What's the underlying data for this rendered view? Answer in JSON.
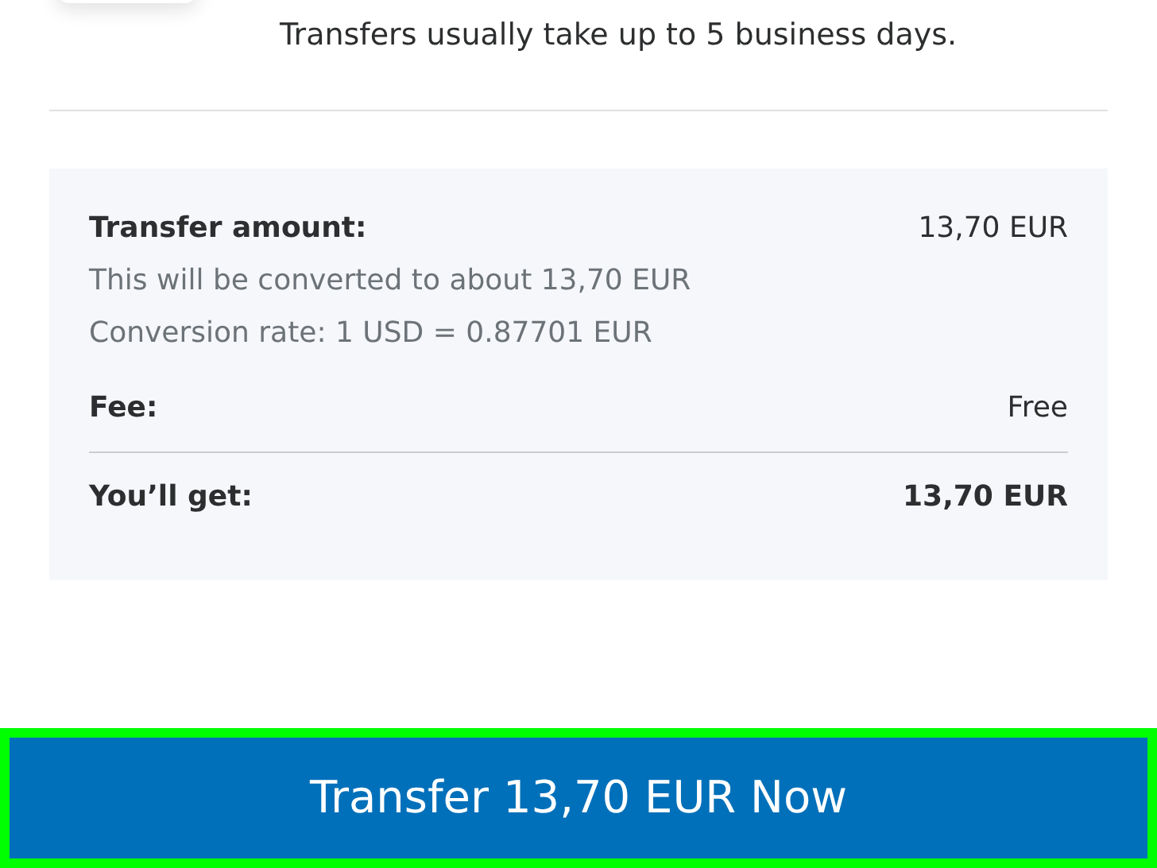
{
  "notice": "Transfers usually take up to 5 business days.",
  "summary": {
    "rows": [
      {
        "kind": "amount",
        "label": "Transfer amount:",
        "value": "13,70 EUR",
        "notes": [
          "This will be converted to about 13,70 EUR",
          "Conversion rate: 1 USD = 0.87701 EUR"
        ]
      },
      {
        "kind": "fee",
        "label": "Fee:",
        "value": "Free"
      },
      {
        "kind": "total",
        "label": "You’ll get:",
        "value": "13,70 EUR"
      }
    ]
  },
  "button": {
    "label": "Transfer 13,70 EUR Now",
    "highlighted": true
  }
}
